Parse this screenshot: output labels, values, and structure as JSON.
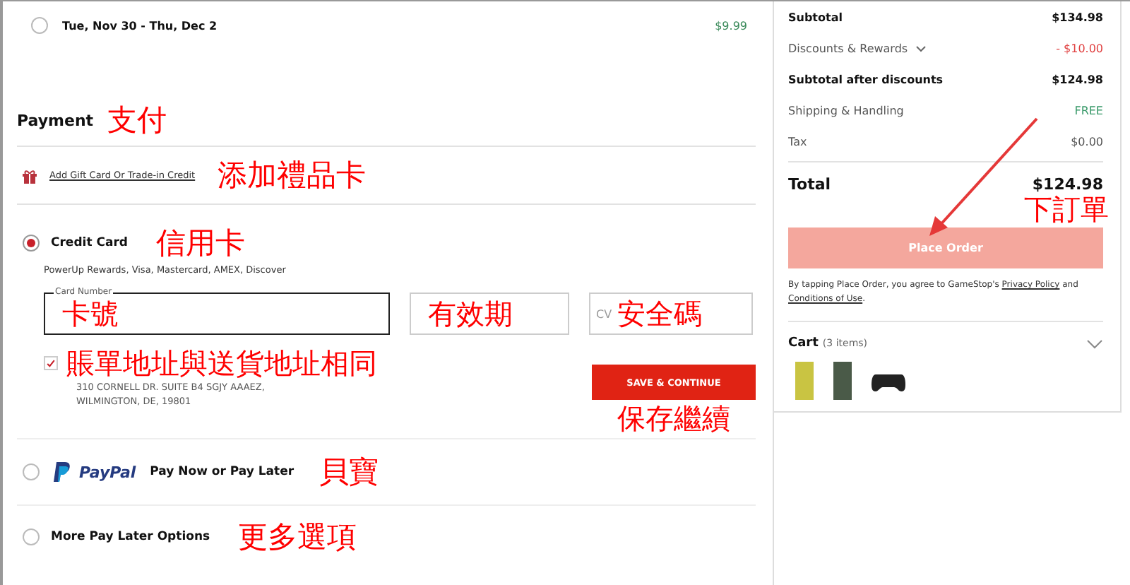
{
  "shipping_option": {
    "label": "Tue, Nov 30 - Thu, Dec 2",
    "price": "$9.99",
    "selected": false
  },
  "payment": {
    "title": "Payment",
    "annotation": "支付"
  },
  "gift_card": {
    "link": "Add Gift Card Or Trade-in Credit",
    "annotation": "添加禮品卡"
  },
  "credit_card": {
    "label": "Credit Card",
    "selected": true,
    "annotation": "信用卡",
    "subtitle": "PowerUp Rewards, Visa, Mastercard, AMEX, Discover",
    "card_number": {
      "label": "Card Number",
      "annotation": "卡號"
    },
    "expiry": {
      "annotation": "有效期"
    },
    "cvv": {
      "placeholder": "CV",
      "annotation": "安全碼"
    },
    "billing_same": {
      "checked": true,
      "annotation": "賬單地址與送貨地址相同"
    },
    "address": [
      "310 CORNELL DR. SUITE B4 SGJY AAAEZ,",
      "WILMINGTON, DE, 19801"
    ],
    "save_button": "SAVE & CONTINUE",
    "save_annotation": "保存繼續"
  },
  "paypal": {
    "logo": "PayPal",
    "label": "Pay Now or Pay Later",
    "selected": false,
    "annotation": "貝寶"
  },
  "more_options": {
    "label": "More Pay Later Options",
    "selected": false,
    "annotation": "更多選項"
  },
  "summary": {
    "rows": [
      {
        "label": "Subtotal",
        "value": "$134.98",
        "kind": "bold"
      },
      {
        "label": "Discounts & Rewards",
        "value": "- $10.00",
        "kind": "discount"
      },
      {
        "label": "Subtotal after discounts",
        "value": "$124.98",
        "kind": "bold"
      },
      {
        "label": "Shipping & Handling",
        "value": "FREE",
        "kind": "free"
      },
      {
        "label": "Tax",
        "value": "$0.00",
        "kind": "plain"
      }
    ],
    "total_label": "Total",
    "total_value": "$124.98",
    "place_order": "Place Order",
    "place_order_annotation": "下訂單",
    "terms": {
      "before": "By tapping Place Order, you agree to GameStop's ",
      "privacy": "Privacy Policy",
      "and": " and ",
      "conditions": "Conditions of Use",
      "end": "."
    },
    "cart": {
      "title": "Cart",
      "count": "(3 items)"
    }
  }
}
